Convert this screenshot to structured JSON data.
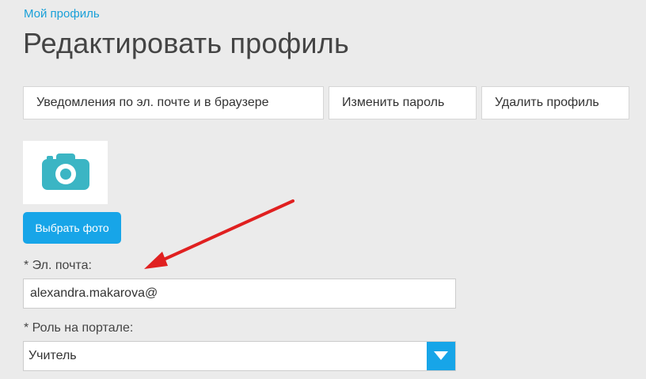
{
  "breadcrumb": {
    "label": "Мой профиль"
  },
  "page_title": "Редактировать профиль",
  "tabs": [
    {
      "label": "Уведомления по эл. почте и в браузере"
    },
    {
      "label": "Изменить пароль"
    },
    {
      "label": "Удалить профиль"
    }
  ],
  "avatar": {
    "icon": "camera-icon",
    "icon_color": "#3bb5c4"
  },
  "choose_photo": {
    "label": "Выбрать фото"
  },
  "email": {
    "label": "* Эл. почта:",
    "value": "alexandra.makarova@"
  },
  "role": {
    "label": "* Роль на портале:",
    "selected": "Учитель"
  },
  "colors": {
    "accent": "#17a5e8",
    "link": "#1aa0d8",
    "annotation": "#e02020"
  }
}
